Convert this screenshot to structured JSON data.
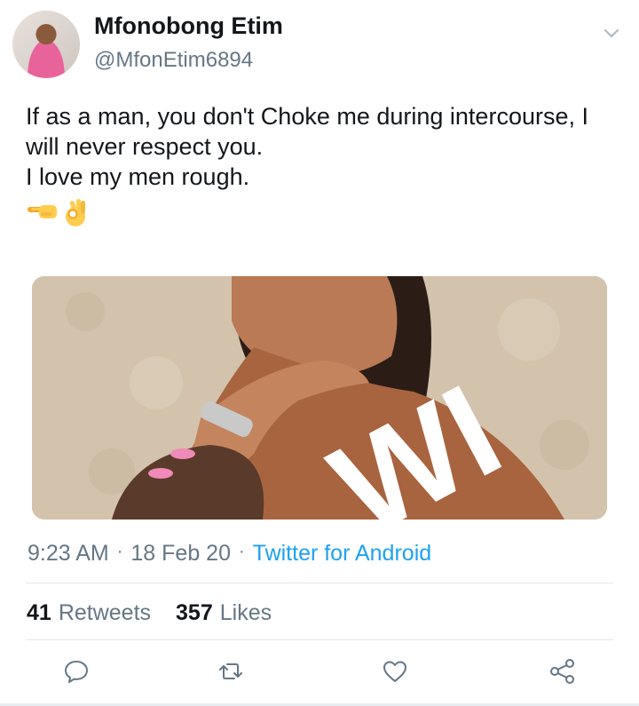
{
  "author": {
    "name": "Mfonobong Etim",
    "handle": "@MfonEtim6894"
  },
  "tweet": {
    "lines": [
      "If as a man, you don't Choke me during intercourse, I",
      "will never respect you.",
      "I love my men rough."
    ],
    "emojis": [
      "backhand-index-pointing-left-icon",
      "ok-hand-icon"
    ]
  },
  "media": {
    "watermark": "WI"
  },
  "meta": {
    "time": "9:23 AM",
    "date": "18 Feb 20",
    "source": "Twitter for Android"
  },
  "stats": {
    "retweets_count": "41",
    "retweets_label": "Retweets",
    "likes_count": "357",
    "likes_label": "Likes"
  },
  "actions": [
    "reply-icon",
    "retweet-icon",
    "like-icon",
    "share-icon"
  ],
  "colors": {
    "link": "#1da1f2",
    "muted": "#657786",
    "text": "#14171a",
    "divider": "#e1e8ed"
  }
}
